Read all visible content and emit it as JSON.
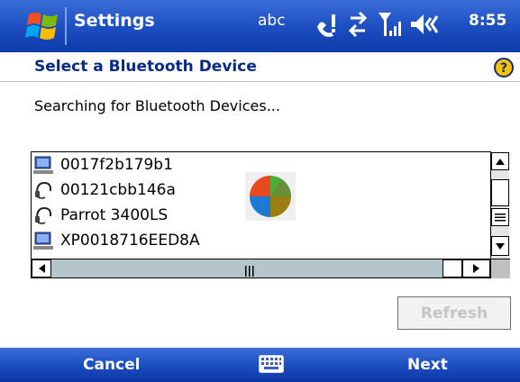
{
  "titlebar": {
    "app_title": "Settings",
    "input_mode": "abc",
    "time": "8:55",
    "icons": [
      "windows-start-icon",
      "connectivity-icon",
      "data-sync-icon",
      "signal-strength-icon",
      "volume-icon"
    ]
  },
  "header": {
    "title": "Select a Bluetooth Device",
    "help_icon": "help-icon"
  },
  "status_text": "Searching for Bluetooth Devices...",
  "devices": [
    {
      "name": "0017f2b179b1",
      "icon": "computer-icon"
    },
    {
      "name": "00121cbb146a",
      "icon": "headset-icon"
    },
    {
      "name": "Parrot 3400LS",
      "icon": "headset-icon"
    },
    {
      "name": "XP0018716EED8A",
      "icon": "computer-icon"
    }
  ],
  "buttons": {
    "refresh": "Refresh"
  },
  "menubar": {
    "left": "Cancel",
    "right": "Next",
    "center_icon": "keyboard-icon"
  },
  "colors": {
    "titlebar": "#1f52c4",
    "header_text": "#0a2a8a",
    "disabled_text": "#c4c4c4"
  }
}
